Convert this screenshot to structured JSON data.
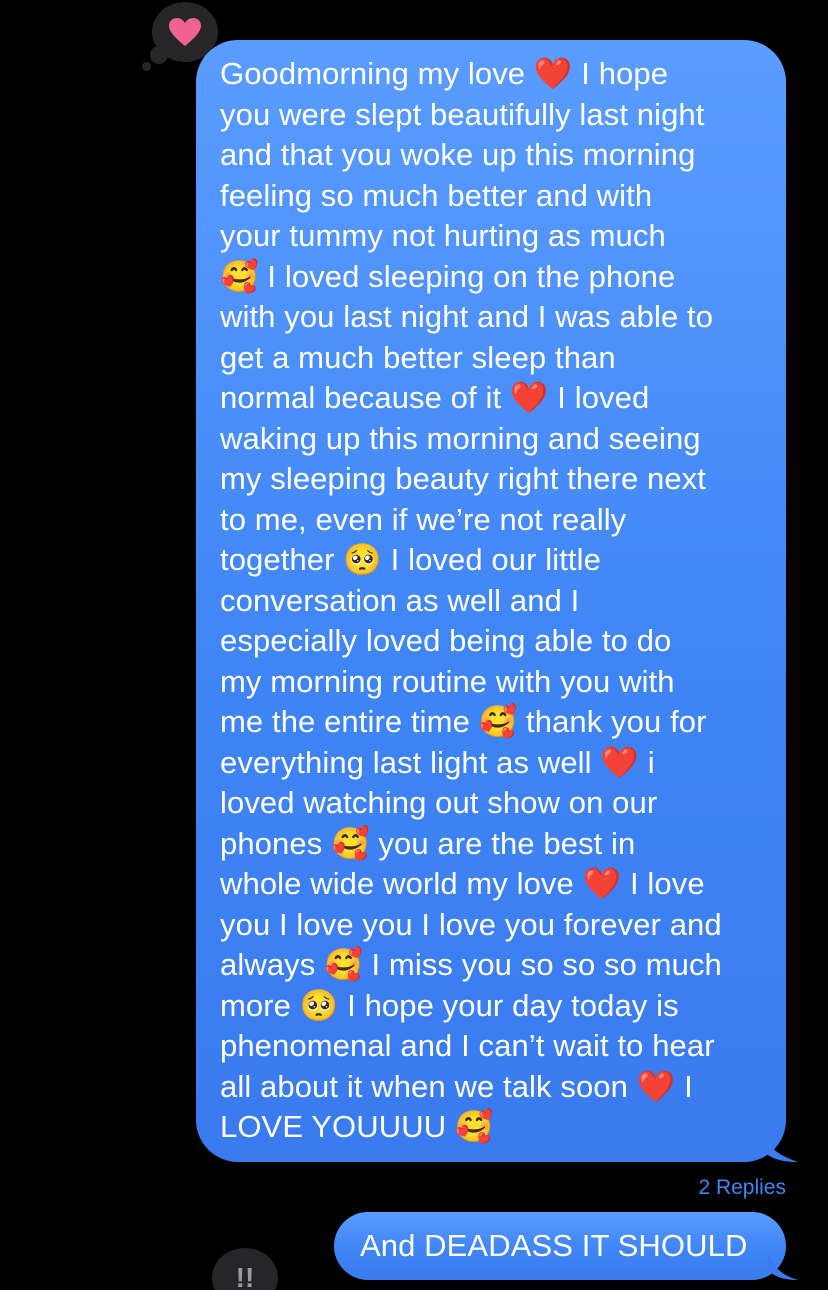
{
  "reactions": {
    "top_tapback_icon": "heart-icon",
    "top_tapback_color": "#f06292",
    "bottom_tapback_label": "!!"
  },
  "messages": [
    {
      "text": "Goodmorning my love ❤️ I hope\nyou were slept beautifully last night\nand that you woke up this morning\nfeeling so much better and with\nyour tummy not hurting as much\n🥰 I loved sleeping on the phone\nwith you last night and I was able to\nget a much better sleep than\nnormal because of it ❤️ I loved\nwaking up this morning and seeing\nmy sleeping beauty right there next\nto me, even if we’re not really\ntogether 🥺 I loved our little\nconversation as well and I\nespecially loved being able to do\nmy morning routine with you with\nme the entire time 🥰 thank you for\neverything last light as well ❤️ i\nloved watching out show on our\nphones 🥰 you are the best in\nwhole wide world my love ❤️ I love\nyou I love you I love you forever and\nalways 🥰 I miss you so so so much\nmore 🥺 I hope your day today is\nphenomenal and I can’t wait to hear\nall about it when we talk soon ❤️ I\nLOVE YOUUUU 🥰",
      "replies_label": "2 Replies"
    },
    {
      "text": "And DEADASS IT SHOULD"
    }
  ],
  "colors": {
    "bubble_blue": "#3f85f5",
    "background": "#000000",
    "tapback_bg": "#262629"
  }
}
